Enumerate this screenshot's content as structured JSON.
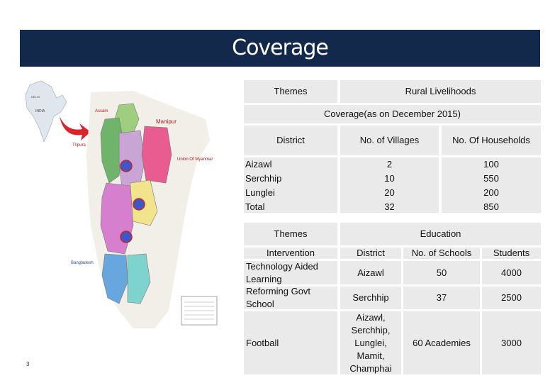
{
  "title": "Coverage",
  "page_number": "3",
  "map": {
    "labels": [
      "Assam",
      "Manipur",
      "Tripura",
      "Union Of Myanmar",
      "Bangladesh",
      "DELHI",
      "INDIA"
    ]
  },
  "coverage": {
    "themes_label": "Themes",
    "theme_value": "Rural Livelihoods",
    "coverage_header": "Coverage(as on December 2015)",
    "columns": [
      "District",
      "No. of Villages",
      "No. Of Households"
    ],
    "districts": [
      "Aizawl",
      "Serchhip",
      "Lunglei",
      "Total"
    ],
    "villages": [
      "2",
      "10",
      "20",
      "32"
    ],
    "households": [
      "100",
      "550",
      "200",
      "850"
    ]
  },
  "education": {
    "themes_label": "Themes",
    "theme_value": "Education",
    "columns": [
      "Intervention",
      "District",
      "No. of Schools",
      "Students"
    ],
    "rows": [
      {
        "intervention": "Technology Aided Learning",
        "district": "Aizawl",
        "schools": "50",
        "students": "4000"
      },
      {
        "intervention": "Reforming Govt School",
        "district": "Serchhip",
        "schools": "37",
        "students": "2500"
      },
      {
        "intervention": "Football",
        "district": "Aizawl, Serchhip, Lunglei, Mamit, Champhai",
        "schools": "60 Academies",
        "students": "3000"
      }
    ]
  }
}
